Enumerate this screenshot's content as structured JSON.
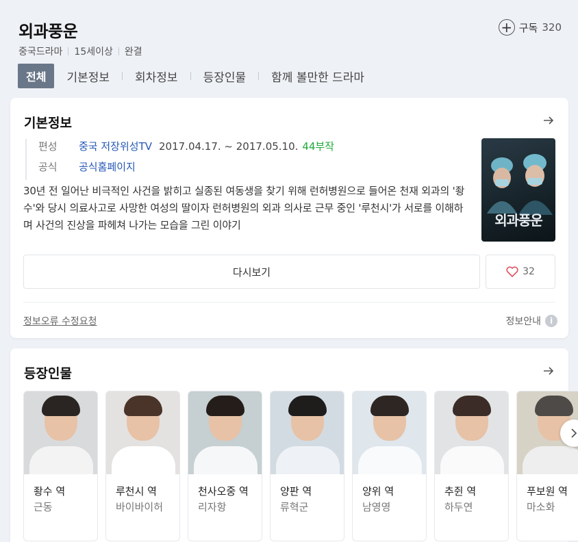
{
  "header": {
    "title": "외과풍운",
    "subscribe_label": "구독",
    "subscribe_count": "320",
    "meta": [
      "중국드라마",
      "15세이상",
      "완결"
    ],
    "tabs": [
      "전체",
      "기본정보",
      "회차정보",
      "등장인물",
      "함께 볼만한 드라마"
    ]
  },
  "basic_info": {
    "title": "기본정보",
    "broadcast_label": "편성",
    "broadcast_value": "중국 저장위성TV",
    "broadcast_dates": "2017.04.17. ~ 2017.05.10.",
    "episodes": "44부작",
    "official_label": "공식",
    "official_value": "공식홈페이지",
    "description": "30년 전 일어난 비극적인 사건을 밝히고 실종된 여동생을 찾기 위해 런허병원으로 들어온 천재 외과의 '좡수'와 당시 의료사고로 사망한 여성의 딸이자 런허병원의 외과 의사로 근무 중인 '루천시'가 서로를 이해하며 사건의 진상을 파헤쳐 나가는 모습을 그린 이야기",
    "poster_title": "외과풍운",
    "rewatch_label": "다시보기",
    "like_count": "32",
    "report_label": "정보오류 수정요청",
    "info_guide_label": "정보안내"
  },
  "cast": {
    "title": "등장인물",
    "members": [
      {
        "role": "좡수 역",
        "actor": "근동",
        "bg": "#d9dadc",
        "hair": "#2a2523",
        "body": "#f3f3f3"
      },
      {
        "role": "루천시 역",
        "actor": "바이바이허",
        "bg": "#e4e2e1",
        "hair": "#4a342a",
        "body": "#ffffff"
      },
      {
        "role": "천사오중 역",
        "actor": "리자항",
        "bg": "#c6cfd1",
        "hair": "#241d1a",
        "body": "#f5f7f8"
      },
      {
        "role": "양판 역",
        "actor": "류혁군",
        "bg": "#d3dbe2",
        "hair": "#1f1c1c",
        "body": "#eef2f6"
      },
      {
        "role": "양위 역",
        "actor": "남영영",
        "bg": "#dfe6ec",
        "hair": "#2e2622",
        "body": "#f8fafc"
      },
      {
        "role": "추쥔 역",
        "actor": "하두연",
        "bg": "#e2e3e5",
        "hair": "#3b2c27",
        "body": "#fafafa"
      },
      {
        "role": "푸보원 역",
        "actor": "마소화",
        "bg": "#d7d2c6",
        "hair": "#4d4a47",
        "body": "#eeeeee"
      }
    ]
  },
  "colors": {
    "accent_tab": "#6a7789",
    "link_blue": "#2457b4",
    "episode_green": "#1eaa38",
    "heart": "#e0505c"
  }
}
